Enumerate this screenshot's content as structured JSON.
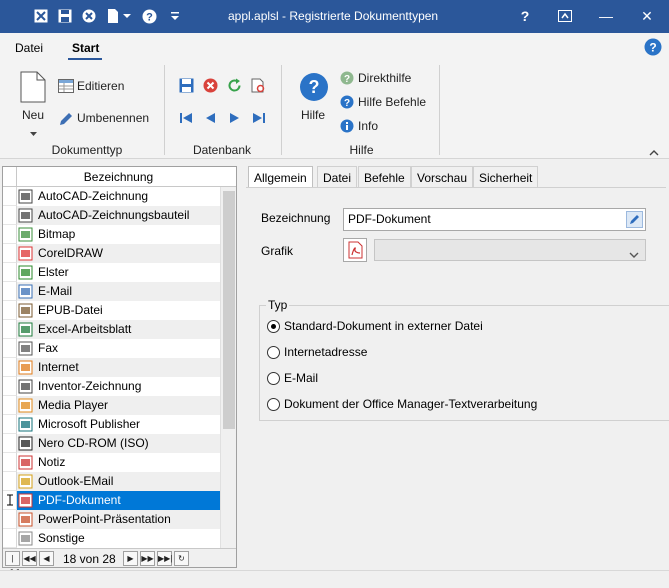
{
  "window": {
    "title": "appl.aplsl - Registrierte Dokumenttypen",
    "help_glyph": "?",
    "restore_glyph": "⧉",
    "minimize_glyph": "—",
    "close_glyph": "✕"
  },
  "ribbon": {
    "tabs": [
      "Datei",
      "Start"
    ],
    "active_tab": "Start",
    "groups": {
      "dokumenttyp": {
        "label": "Dokumenttyp",
        "neu_label": "Neu",
        "editieren_label": "Editieren",
        "umbenennen_label": "Umbenennen"
      },
      "datenbank": {
        "label": "Datenbank"
      },
      "hilfe": {
        "label": "Hilfe",
        "hilfe_label": "Hilfe",
        "direkthilfe_label": "Direkthilfe",
        "hilfe_befehle_label": "Hilfe Befehle",
        "info_label": "Info"
      }
    }
  },
  "list": {
    "header": "Bezeichnung",
    "items": [
      {
        "label": "AutoCAD-Zeichnung",
        "icon": "autocad-drawing-icon"
      },
      {
        "label": "AutoCAD-Zeichnungsbauteil",
        "icon": "autocad-part-icon"
      },
      {
        "label": "Bitmap",
        "icon": "bitmap-icon"
      },
      {
        "label": "CorelDRAW",
        "icon": "coreldraw-icon"
      },
      {
        "label": "Elster",
        "icon": "elster-icon"
      },
      {
        "label": "E-Mail",
        "icon": "email-icon"
      },
      {
        "label": "EPUB-Datei",
        "icon": "epub-icon"
      },
      {
        "label": "Excel-Arbeitsblatt",
        "icon": "excel-icon"
      },
      {
        "label": "Fax",
        "icon": "fax-icon"
      },
      {
        "label": "Internet",
        "icon": "internet-icon"
      },
      {
        "label": "Inventor-Zeichnung",
        "icon": "inventor-icon"
      },
      {
        "label": "Media Player",
        "icon": "media-player-icon"
      },
      {
        "label": "Microsoft Publisher",
        "icon": "publisher-icon"
      },
      {
        "label": "Nero CD-ROM (ISO)",
        "icon": "nero-icon"
      },
      {
        "label": "Notiz",
        "icon": "note-icon"
      },
      {
        "label": "Outlook-EMail",
        "icon": "outlook-mail-icon"
      },
      {
        "label": "PDF-Dokument",
        "icon": "pdf-icon"
      },
      {
        "label": "PowerPoint-Präsentation",
        "icon": "powerpoint-icon"
      },
      {
        "label": "Sonstige",
        "icon": "other-icon"
      }
    ],
    "selected_index": 16,
    "record_position": "18 von 28"
  },
  "detail": {
    "tabs": [
      "Allgemein",
      "Datei",
      "Befehle",
      "Vorschau",
      "Sicherheit"
    ],
    "active_tab": "Allgemein",
    "bezeichnung_label": "Bezeichnung",
    "bezeichnung_value": "PDF-Dokument",
    "grafik_label": "Grafik",
    "typ_legend": "Typ",
    "typ_options": [
      "Standard-Dokument in externer Datei",
      "Internetadresse",
      "E-Mail",
      "Dokument der Office Manager-Textverarbeitung"
    ],
    "typ_selected": 0
  },
  "colors": {
    "titlebar": "#2b579a",
    "selection": "#0078d7",
    "help_blue": "#2a73c7"
  }
}
